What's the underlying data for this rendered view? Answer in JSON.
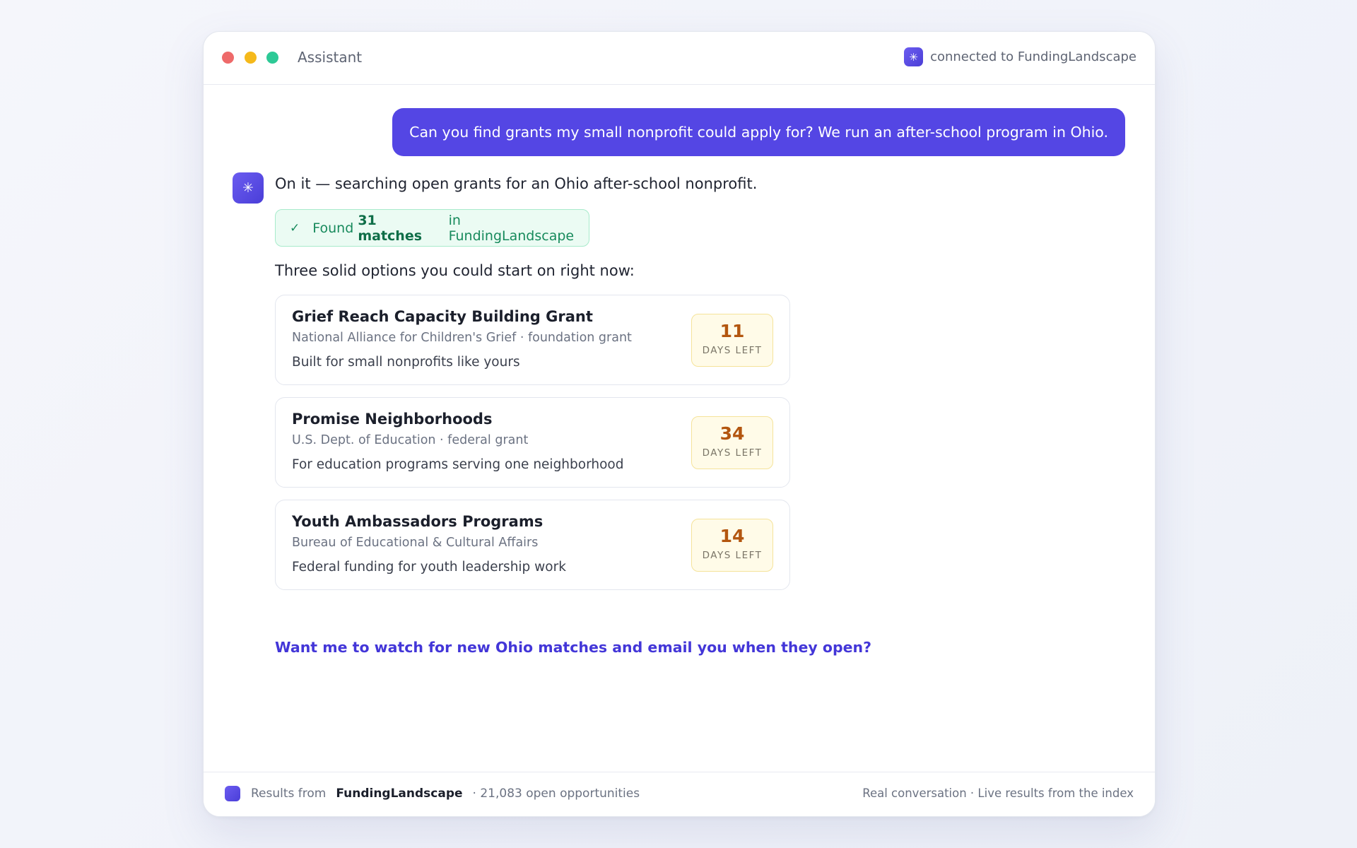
{
  "window": {
    "title": "Assistant",
    "connection": "connected to FundingLandscape",
    "connection_icon": "sparkle-icon"
  },
  "conversation": {
    "user_message": "Can you find grants my small nonprofit could apply for? We run an after-school program in Ohio.",
    "assistant_intro": "On it — searching open grants for an Ohio after-school nonprofit.",
    "found": {
      "prefix": "Found",
      "count": "31 matches",
      "suffix": "in FundingLandscape"
    },
    "lead": "Three solid options you could start on right now:",
    "grants": [
      {
        "title": "Grief Reach Capacity Building Grant",
        "subtitle": "National Alliance for Children's Grief · foundation grant",
        "description": "Built for small nonprofits like yours",
        "days": "11",
        "days_label": "DAYS LEFT"
      },
      {
        "title": "Promise Neighborhoods",
        "subtitle": "U.S. Dept. of Education · federal grant",
        "description": "For education programs serving one neighborhood",
        "days": "34",
        "days_label": "DAYS LEFT"
      },
      {
        "title": "Youth Ambassadors Programs",
        "subtitle": "Bureau of Educational & Cultural Affairs",
        "description": "Federal funding for youth leadership work",
        "days": "14",
        "days_label": "DAYS LEFT"
      }
    ],
    "followup": "Want me to watch for new Ohio matches and email you when they open?"
  },
  "footer": {
    "prefix": "Results from",
    "brand": "FundingLandscape",
    "count": "· 21,083 open opportunities",
    "right": "Real conversation · Live results from the index"
  },
  "colors": {
    "accent": "#5446e4",
    "success": "#178a5c",
    "deadline": "#b3560f"
  }
}
